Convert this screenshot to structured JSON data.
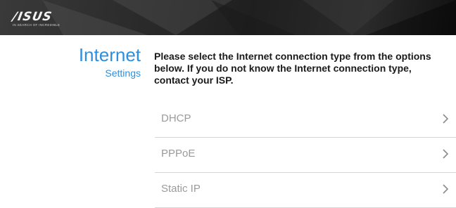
{
  "header": {
    "logo_text": "/ISUS",
    "logo_tagline": "IN SEARCH OF INCREDIBLE"
  },
  "page": {
    "title": "Internet",
    "subtitle": "Settings",
    "instructions": "Please select the Internet connection type from the options below. If you do not know the Internet connection type, contact your ISP."
  },
  "options": [
    {
      "label": "DHCP",
      "icon": "chevron-right-icon"
    },
    {
      "label": "PPPoE",
      "icon": "chevron-right-icon"
    },
    {
      "label": "Static IP",
      "icon": "chevron-right-icon"
    }
  ],
  "colors": {
    "accent": "#2f8fdc",
    "option_text": "#9a9a9a",
    "divider": "#d5d5d5"
  }
}
